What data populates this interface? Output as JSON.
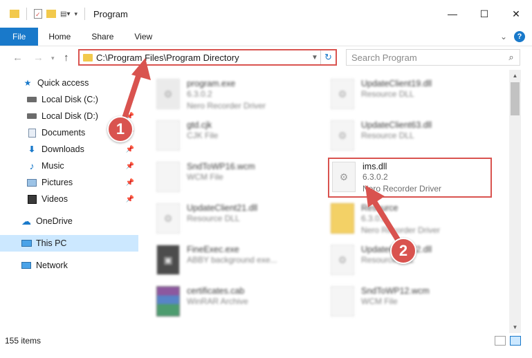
{
  "window": {
    "title": "Program",
    "minimize": "—",
    "maximize": "☐",
    "close": "✕"
  },
  "ribbon": {
    "tabs": [
      "File",
      "Home",
      "Share",
      "View"
    ],
    "expand": "⌄",
    "help": "?"
  },
  "address": {
    "path": "C:\\Program Files\\Program Directory",
    "search_placeholder": "Search Program"
  },
  "sidebar": {
    "items": [
      {
        "label": "Quick access",
        "icon": "star-icon"
      },
      {
        "label": "Local Disk (C:)",
        "icon": "drive-icon"
      },
      {
        "label": "Local Disk (D:)",
        "icon": "drive-icon"
      },
      {
        "label": "Documents",
        "icon": "documents-icon"
      },
      {
        "label": "Downloads",
        "icon": "download-icon"
      },
      {
        "label": "Music",
        "icon": "music-icon"
      },
      {
        "label": "Pictures",
        "icon": "pictures-icon"
      },
      {
        "label": "Videos",
        "icon": "videos-icon"
      },
      {
        "label": "OneDrive",
        "icon": "cloud-icon"
      },
      {
        "label": "This PC",
        "icon": "computer-icon"
      },
      {
        "label": "Network",
        "icon": "network-icon"
      }
    ]
  },
  "files": [
    {
      "name": "program.exe",
      "line2": "6.3.0.2",
      "line3": "Nero Recorder Driver",
      "kind": "exe"
    },
    {
      "name": "UpdateClient19.dll",
      "line2": "Resource DLL",
      "line3": "",
      "kind": "dll"
    },
    {
      "name": "gtd.cjk",
      "line2": "CJK File",
      "line3": "",
      "kind": "file"
    },
    {
      "name": "UpdateClient63.dll",
      "line2": "Resource DLL",
      "line3": "",
      "kind": "dll"
    },
    {
      "name": "SndToWP16.wcm",
      "line2": "WCM File",
      "line3": "",
      "kind": "file"
    },
    {
      "name": "ims.dll",
      "line2": "6.3.0.2",
      "line3": "Nero Recorder Driver",
      "kind": "dll"
    },
    {
      "name": "UpdateClient21.dll",
      "line2": "Resource DLL",
      "line3": "",
      "kind": "dll"
    },
    {
      "name": "Resource",
      "line2": "6.3.0.2",
      "line3": "Nero Recorder Driver",
      "kind": "folder"
    },
    {
      "name": "FineExec.exe",
      "line2": "ABBY background exe...",
      "line3": "",
      "kind": "exe"
    },
    {
      "name": "UpdateClient42.dll",
      "line2": "Resource DLL",
      "line3": "",
      "kind": "dll"
    },
    {
      "name": "certificates.cab",
      "line2": "WinRAR Archive",
      "line3": "",
      "kind": "archive"
    },
    {
      "name": "SndToWP12.wcm",
      "line2": "WCM File",
      "line3": "",
      "kind": "file"
    }
  ],
  "status": {
    "items_count": "155 items"
  },
  "callouts": [
    "1",
    "2"
  ],
  "colors": {
    "accent": "#1979ca",
    "highlight_red": "#d9534f",
    "selected": "#cce8ff"
  }
}
